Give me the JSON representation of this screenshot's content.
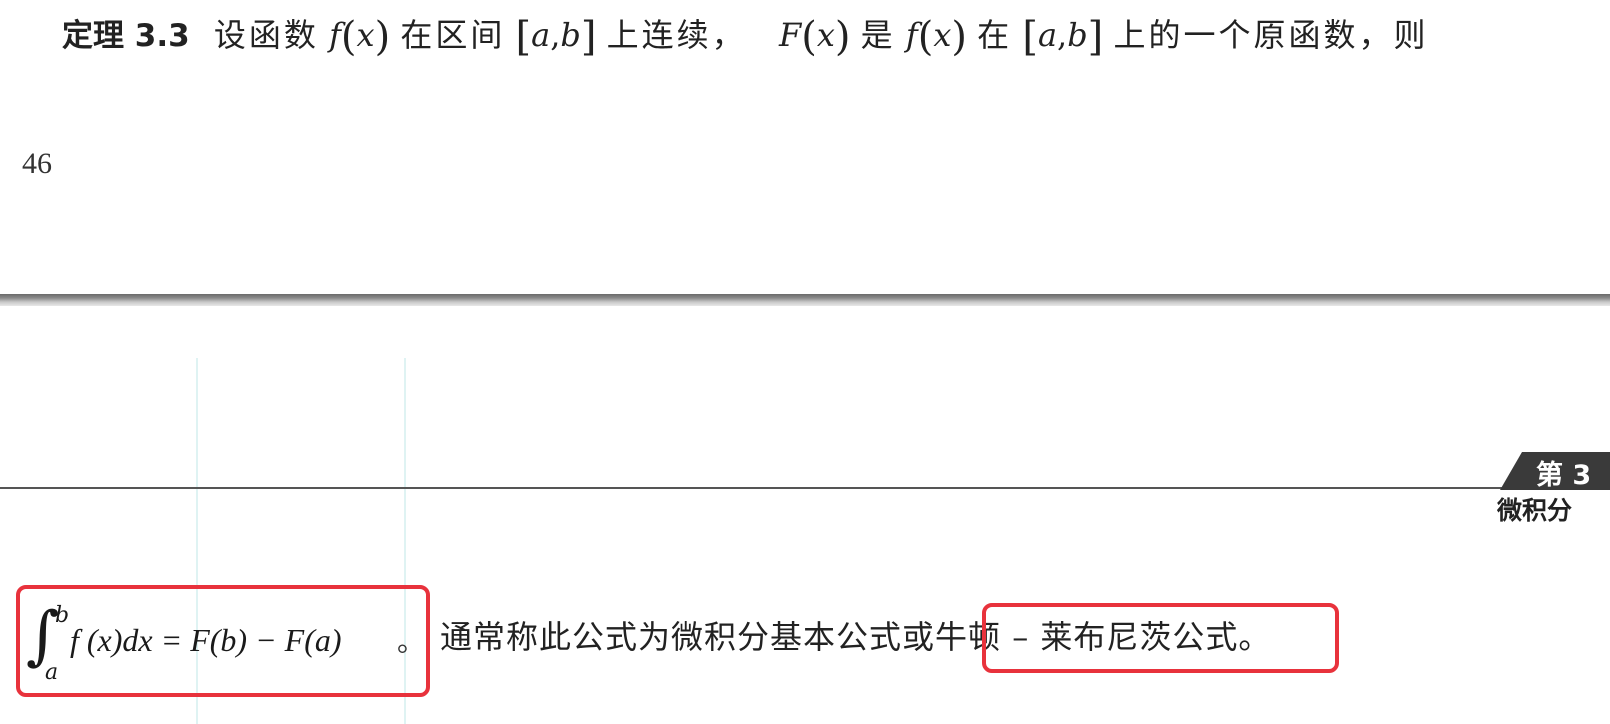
{
  "theorem": {
    "label": "定理 3.3",
    "t1": "设函数",
    "f": "f",
    "x": "x",
    "t2": "在区间",
    "a": "a",
    "comma": ",",
    "b": "b",
    "t3": "上连续，",
    "F": "F",
    "t4": "是",
    "t5": "在",
    "t6": "上的一个原函数，则"
  },
  "page_number": "46",
  "chapter_tab": {
    "word": "第 3",
    "subtitle": "微积分"
  },
  "formula": {
    "integral": "∫",
    "upper_limit": "b",
    "lower_limit": "a",
    "body": "f (x)dx = F(b) − F(a)",
    "period": "。"
  },
  "statement": {
    "lead": "通常称此公式为微积分基本公式或",
    "highlighted": "牛顿 – 莱布尼茨公式。"
  },
  "colors": {
    "highlight_border": "#e8323c",
    "chapter_tab_bg": "#3a3a3a"
  }
}
